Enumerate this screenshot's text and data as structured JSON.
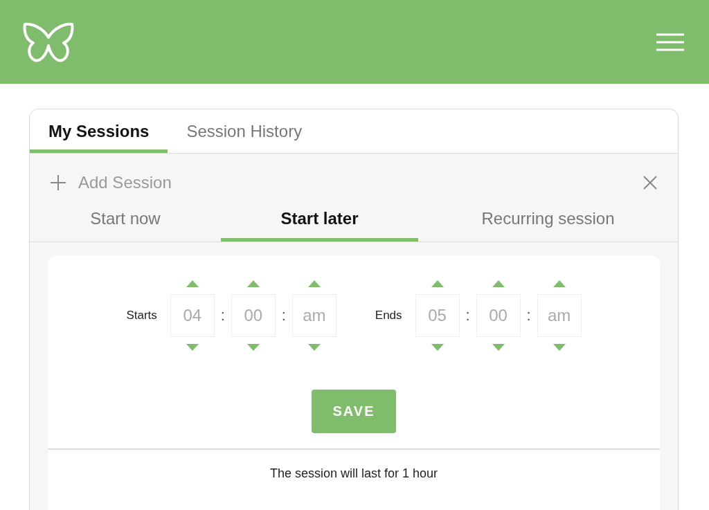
{
  "tabs": [
    {
      "label": "My Sessions",
      "selected": true
    },
    {
      "label": "Session History",
      "selected": false
    }
  ],
  "add_session": {
    "label": "Add Session"
  },
  "mode_tabs": [
    {
      "label": "Start now",
      "selected": false
    },
    {
      "label": "Start later",
      "selected": true
    },
    {
      "label": "Recurring session",
      "selected": false
    }
  ],
  "times": [
    {
      "label": "Starts",
      "separator": ":",
      "fields": [
        "04",
        "00",
        "am"
      ]
    },
    {
      "label": "Ends",
      "separator": ":",
      "fields": [
        "05",
        "00",
        "am"
      ]
    }
  ],
  "save_button": {
    "label": "SAVE"
  },
  "duration_text": "The session will last for 1 hour"
}
